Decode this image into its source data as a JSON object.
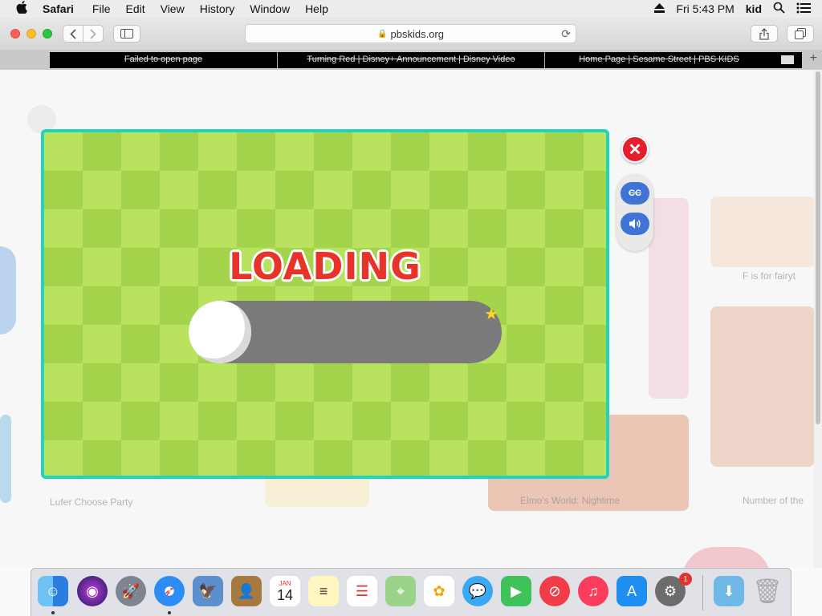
{
  "menubar": {
    "apple": "",
    "app": "Safari",
    "items": [
      "File",
      "Edit",
      "View",
      "History",
      "Window",
      "Help"
    ],
    "clock": "Fri 5:43 PM",
    "user": "kid"
  },
  "toolbar": {
    "url": "pbskids.org",
    "lock": "🔒"
  },
  "tabs": [
    {
      "title": "Failed to open page"
    },
    {
      "title": "Turning Red | Disney+ Announcement | Disney Video"
    },
    {
      "title": "Home Page | Sesame Street | PBS KIDS"
    }
  ],
  "page": {
    "bg_labels": [
      "Lufer Choose Party",
      "Elmo's World: Nightime",
      "Number of the",
      "F is for fairyt"
    ],
    "game": {
      "loading_text": "LOADING",
      "progress": 0.0,
      "close_glyph": "✕",
      "cc_label": "CC",
      "sound_glyph": "🔊"
    }
  },
  "dock": {
    "apps": [
      "Finder",
      "Siri",
      "Launchpad",
      "Safari",
      "Preview",
      "Contacts",
      "Calendar",
      "Notes",
      "Reminders",
      "Maps",
      "Photos",
      "Messages",
      "FaceTime",
      "News",
      "Music",
      "App Store",
      "System Preferences",
      "Downloads",
      "Trash"
    ],
    "calendar_month": "JAN",
    "calendar_day": "14",
    "settings_badge": "1"
  },
  "colors": {
    "frame": "#20d2c0",
    "checker_light": "#b9e35e",
    "checker_dark": "#a4d44c",
    "loading": "#e8332b",
    "bar": "#7a7a7a",
    "close": "#e51e2e",
    "control_blue": "#3f73d6"
  }
}
